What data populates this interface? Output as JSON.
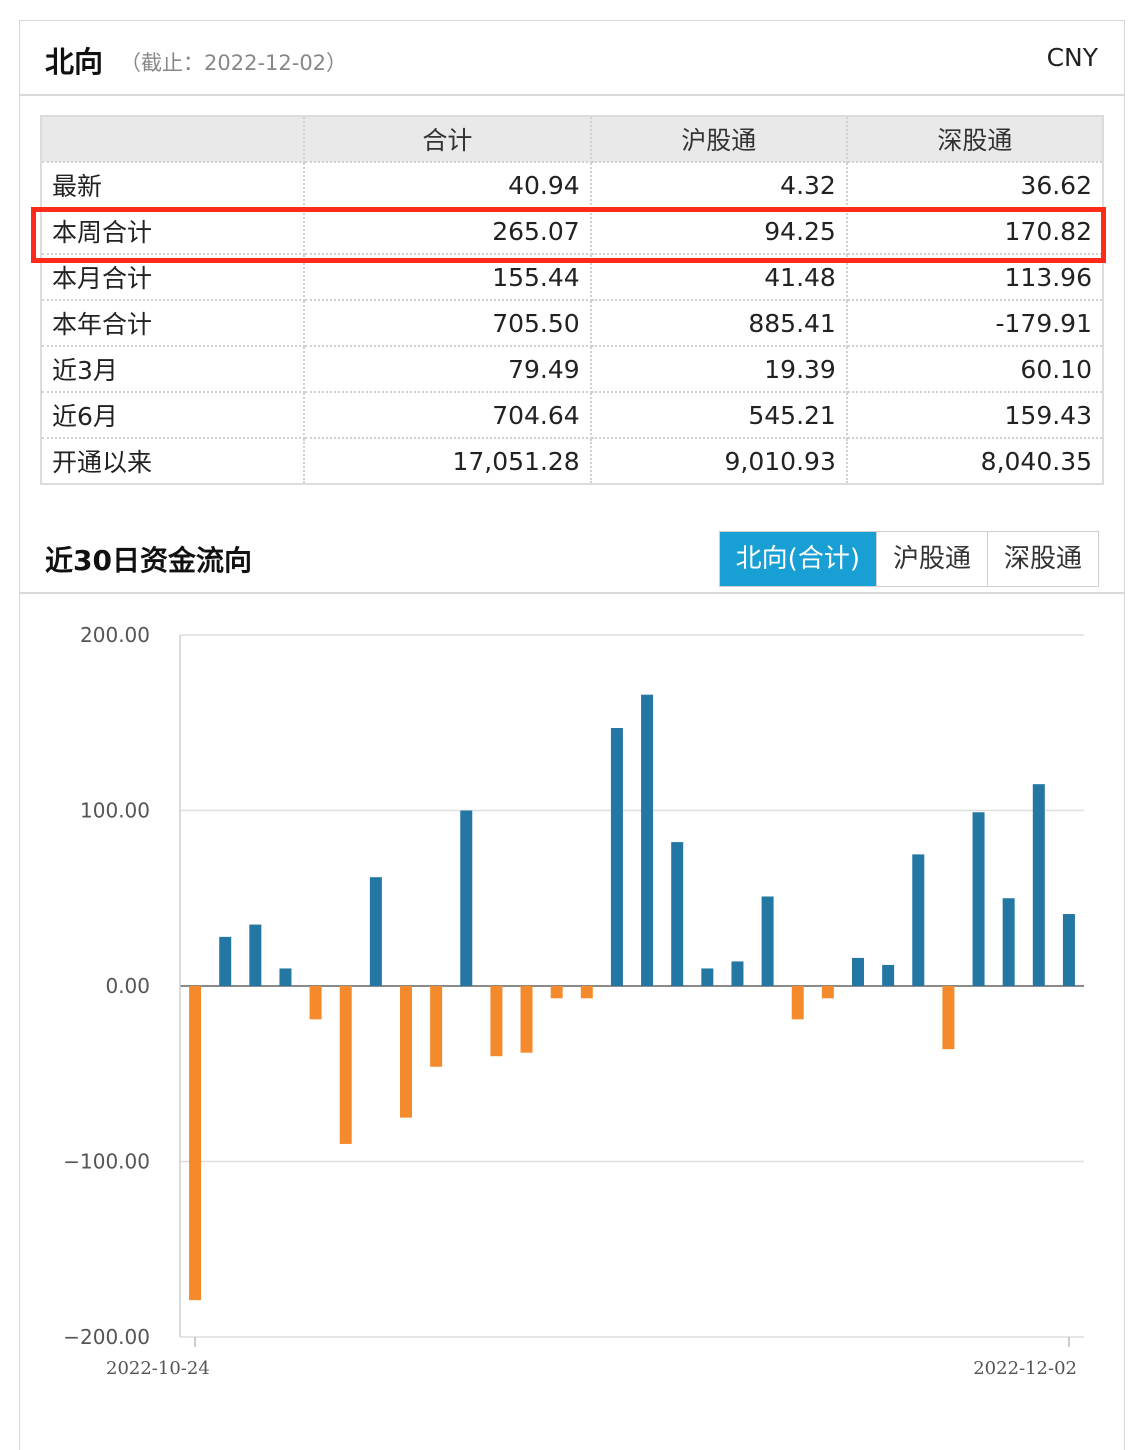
{
  "header": {
    "title": "北向",
    "subtitle": "（截止：2022-12-02）",
    "currency": "CNY"
  },
  "summary": {
    "columns": [
      "",
      "合计",
      "沪股通",
      "深股通"
    ],
    "rows": [
      {
        "label": "最新",
        "total": "40.94",
        "sh": "4.32",
        "sz": "36.62"
      },
      {
        "label": "本周合计",
        "total": "265.07",
        "sh": "94.25",
        "sz": "170.82"
      },
      {
        "label": "本月合计",
        "total": "155.44",
        "sh": "41.48",
        "sz": "113.96"
      },
      {
        "label": "本年合计",
        "total": "705.50",
        "sh": "885.41",
        "sz": "-179.91"
      },
      {
        "label": "近3月",
        "total": "79.49",
        "sh": "19.39",
        "sz": "60.10"
      },
      {
        "label": "近6月",
        "total": "704.64",
        "sh": "545.21",
        "sz": "159.43"
      },
      {
        "label": "开通以来",
        "total": "17,051.28",
        "sh": "9,010.93",
        "sz": "8,040.35"
      }
    ]
  },
  "section": {
    "title": "近30日资金流向",
    "tabs": [
      {
        "label": "北向(合计)",
        "active": true
      },
      {
        "label": "沪股通",
        "active": false
      },
      {
        "label": "深股通",
        "active": false
      }
    ]
  },
  "colors": {
    "positive": "#2477a3",
    "negative": "#f58a2c",
    "highlight": "#ff2a1a",
    "tab_active": "#189fd3"
  },
  "chart_data": {
    "type": "bar",
    "ylim": [
      -200,
      200
    ],
    "yticks": [
      "200.00",
      "100.00",
      "0.00",
      "−100.00",
      "−200.00"
    ],
    "ytick_values": [
      200,
      100,
      0,
      -100,
      -200
    ],
    "x_start_label": "2022-10-24",
    "x_end_label": "2022-12-02",
    "grid": true,
    "values": [
      -179,
      28,
      35,
      10,
      -19,
      -90,
      62,
      -75,
      -46,
      100,
      -40,
      -38,
      -7,
      -7,
      147,
      166,
      82,
      10,
      14,
      51,
      -19,
      -7,
      16,
      12,
      75,
      -36,
      99,
      50,
      115,
      41
    ]
  }
}
